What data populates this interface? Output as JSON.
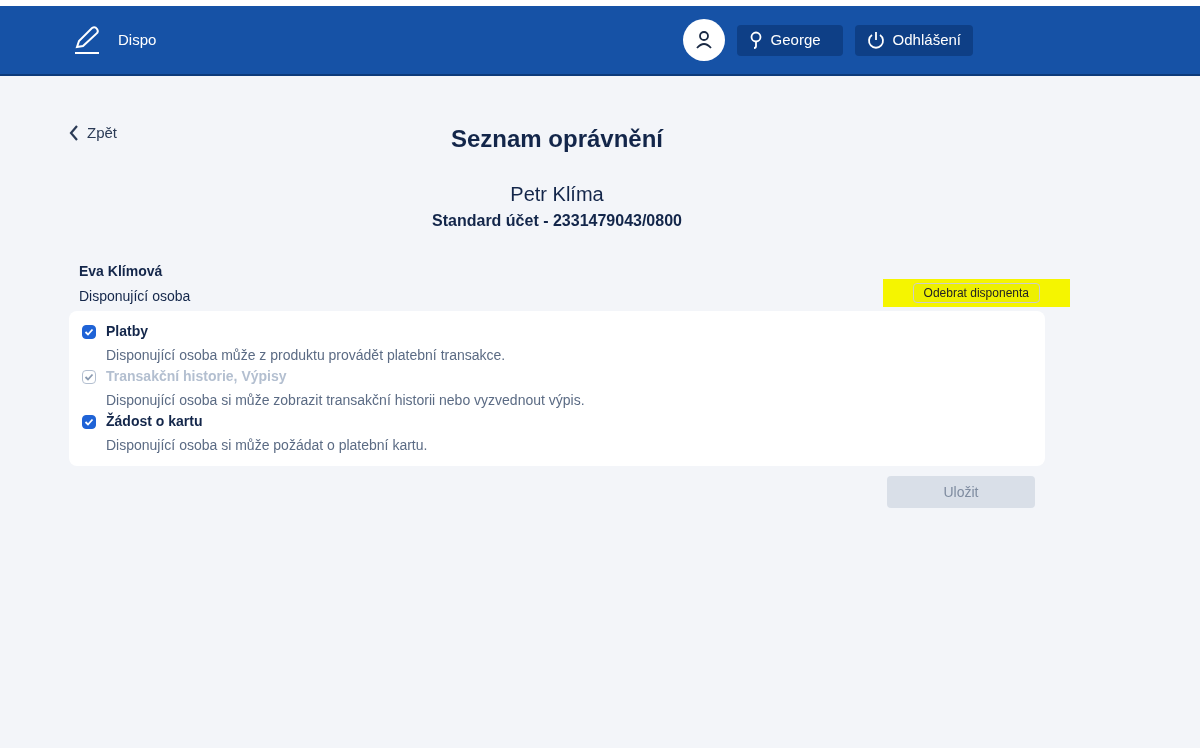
{
  "header": {
    "app_name": "Dispo",
    "user_button": "George",
    "logout_button": "Odhlášení"
  },
  "back_link": "Zpět",
  "title": "Seznam oprávnění",
  "owner": {
    "name": "Petr Klíma",
    "account": "Standard účet - 2331479043/0800"
  },
  "disponent": {
    "name": "Eva Klímová",
    "role": "Disponující osoba",
    "remove_button": {
      "label": "Odebrat disponenta",
      "highlighted": true
    }
  },
  "permissions": [
    {
      "label": "Platby",
      "description": "Disponující osoba může z produktu provádět platební transakce.",
      "checked": true,
      "disabled": false
    },
    {
      "label": "Transakční historie, Výpisy",
      "description": "Disponující osoba si může zobrazit transakční historii nebo vyzvednout výpis.",
      "checked": true,
      "disabled": true
    },
    {
      "label": "Žádost o kartu",
      "description": "Disponující osoba si může požádat o platební kartu.",
      "checked": true,
      "disabled": false
    }
  ],
  "save_button": {
    "label": "Uložit",
    "disabled": true
  }
}
